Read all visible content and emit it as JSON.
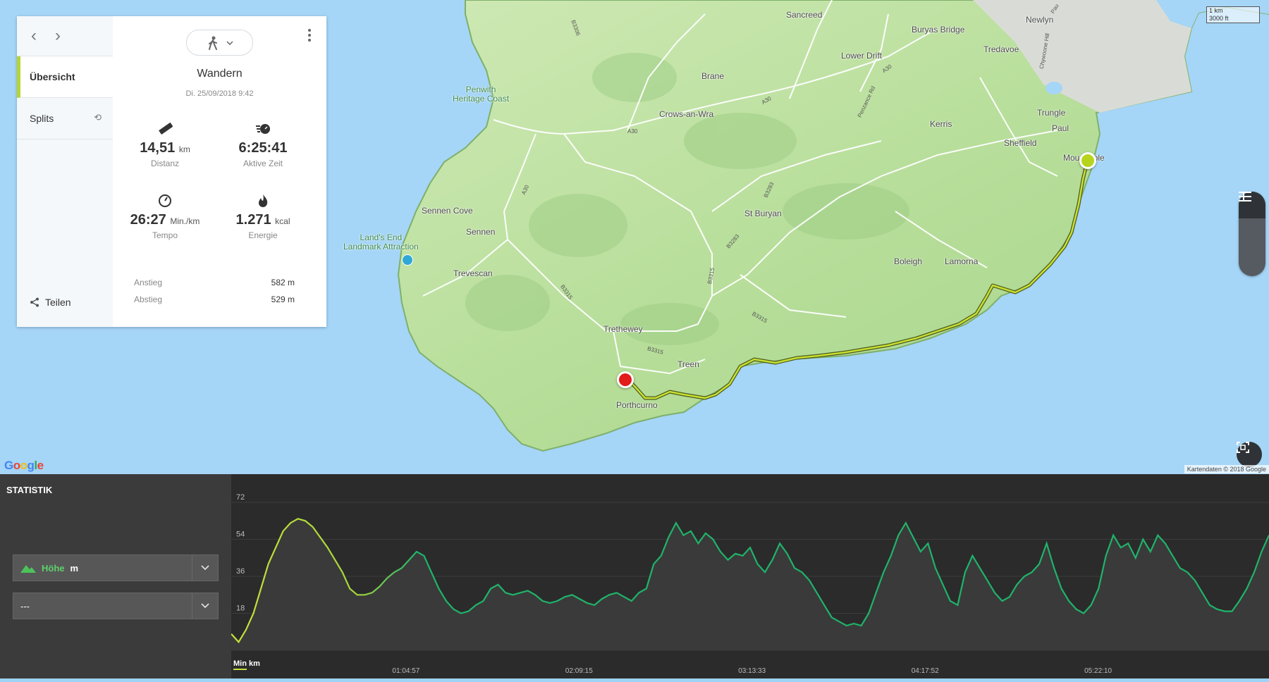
{
  "panel": {
    "nav": {
      "back_icon": "‹",
      "forward_icon": "›"
    },
    "tabs": [
      {
        "label": "Übersicht"
      },
      {
        "label": "Splits"
      }
    ],
    "share_label": "Teilen",
    "activity": {
      "type": "Wandern",
      "date": "Di. 25/09/2018 9:42"
    },
    "stats": {
      "distance": {
        "value": "14,51",
        "unit": "km",
        "label": "Distanz"
      },
      "active_time": {
        "value": "6:25:41",
        "unit": "",
        "label": "Aktive Zeit"
      },
      "pace": {
        "value": "26:27",
        "unit": "Min./km",
        "label": "Tempo"
      },
      "energy": {
        "value": "1.271",
        "unit": "kcal",
        "label": "Energie"
      }
    },
    "ascent": {
      "label": "Anstieg",
      "value": "582 m"
    },
    "descent": {
      "label": "Abstieg",
      "value": "529 m"
    }
  },
  "map": {
    "places": {
      "sancreed": "Sancreed",
      "newlyn": "Newlyn",
      "buryas": "Buryas Bridge",
      "tredavoe": "Tredavoe",
      "lowerdrift": "Lower Drift",
      "brane": "Brane",
      "penwith": "Penwith\nHeritage Coast",
      "trungle": "Trungle",
      "paul": "Paul",
      "crows": "Crows-an-Wra",
      "kerris": "Kerris",
      "sheffield": "Sheffield",
      "mousehole": "Mousehole",
      "sennencove": "Sennen Cove",
      "stburyan": "St Buryan",
      "sennen": "Sennen",
      "landsend": "Land's End\nLandmark Attraction",
      "boleigh": "Boleigh",
      "lamorna": "Lamorna",
      "trevescan": "Trevescan",
      "trethewey": "Trethewey",
      "treen": "Treen",
      "porthcurno": "Porthcurno"
    },
    "roads": {
      "b3306": "B3306",
      "a30a": "A30",
      "a30b": "A30",
      "a30c": "A30",
      "a30d": "A30",
      "b3315a": "B3315",
      "b3315b": "B3315",
      "b3315c": "B3315",
      "b3283a": "B3283",
      "b3283b": "B3283",
      "penzance": "Penzance Rd",
      "chywoone": "Chywoone Hill",
      "b3315d": "B3315",
      "pau": "Pau"
    },
    "scale": {
      "km": "1 km",
      "ft": "3000 ft"
    },
    "attribution": "Kartendaten © 2018 Google",
    "google": [
      "G",
      "o",
      "o",
      "g",
      "l",
      "e"
    ]
  },
  "statistik": {
    "title": "STATISTIK",
    "primary": {
      "label": "Höhe",
      "unit": "m"
    },
    "secondary": {
      "label": "---"
    },
    "x_unit_min": "Min",
    "x_unit_km": "km"
  },
  "chart_data": {
    "type": "area",
    "title": "",
    "xlabel": "",
    "ylabel": "",
    "ylim": [
      0,
      72
    ],
    "yticks": [
      0,
      18,
      36,
      54,
      72
    ],
    "xticks": [
      "01:04:57",
      "02:09:15",
      "03:13:33",
      "04:17:52",
      "05:22:10"
    ],
    "xlim_seconds": [
      0,
      23141
    ],
    "series": [
      {
        "values": [
          8,
          4,
          10,
          18,
          30,
          42,
          50,
          58,
          62,
          64,
          63,
          60,
          55,
          50,
          44,
          38,
          30,
          27,
          27,
          28,
          31,
          35,
          38,
          40,
          44,
          48,
          46,
          38,
          30,
          24,
          20,
          18,
          19,
          22,
          24,
          30,
          32,
          28,
          27,
          28,
          29,
          27,
          24,
          23,
          24,
          26,
          27,
          25,
          23,
          22,
          25,
          27,
          28,
          26,
          24,
          28,
          30,
          42,
          46,
          55,
          62,
          56,
          58,
          52,
          57,
          54,
          48,
          44,
          47,
          46,
          50,
          42,
          38,
          44,
          52,
          47,
          40,
          38,
          34,
          28,
          22,
          16,
          14,
          12,
          13,
          12,
          18,
          28,
          38,
          46,
          56,
          62,
          55,
          48,
          52,
          40,
          32,
          24,
          22,
          38,
          46,
          40,
          34,
          28,
          24,
          26,
          32,
          36,
          38,
          42,
          52,
          40,
          30,
          24,
          20,
          18,
          22,
          30,
          46,
          56,
          50,
          52,
          45,
          54,
          48,
          56,
          52,
          46,
          40,
          38,
          34,
          28,
          22,
          20,
          19,
          19,
          24,
          30,
          38,
          48,
          56
        ]
      }
    ]
  }
}
